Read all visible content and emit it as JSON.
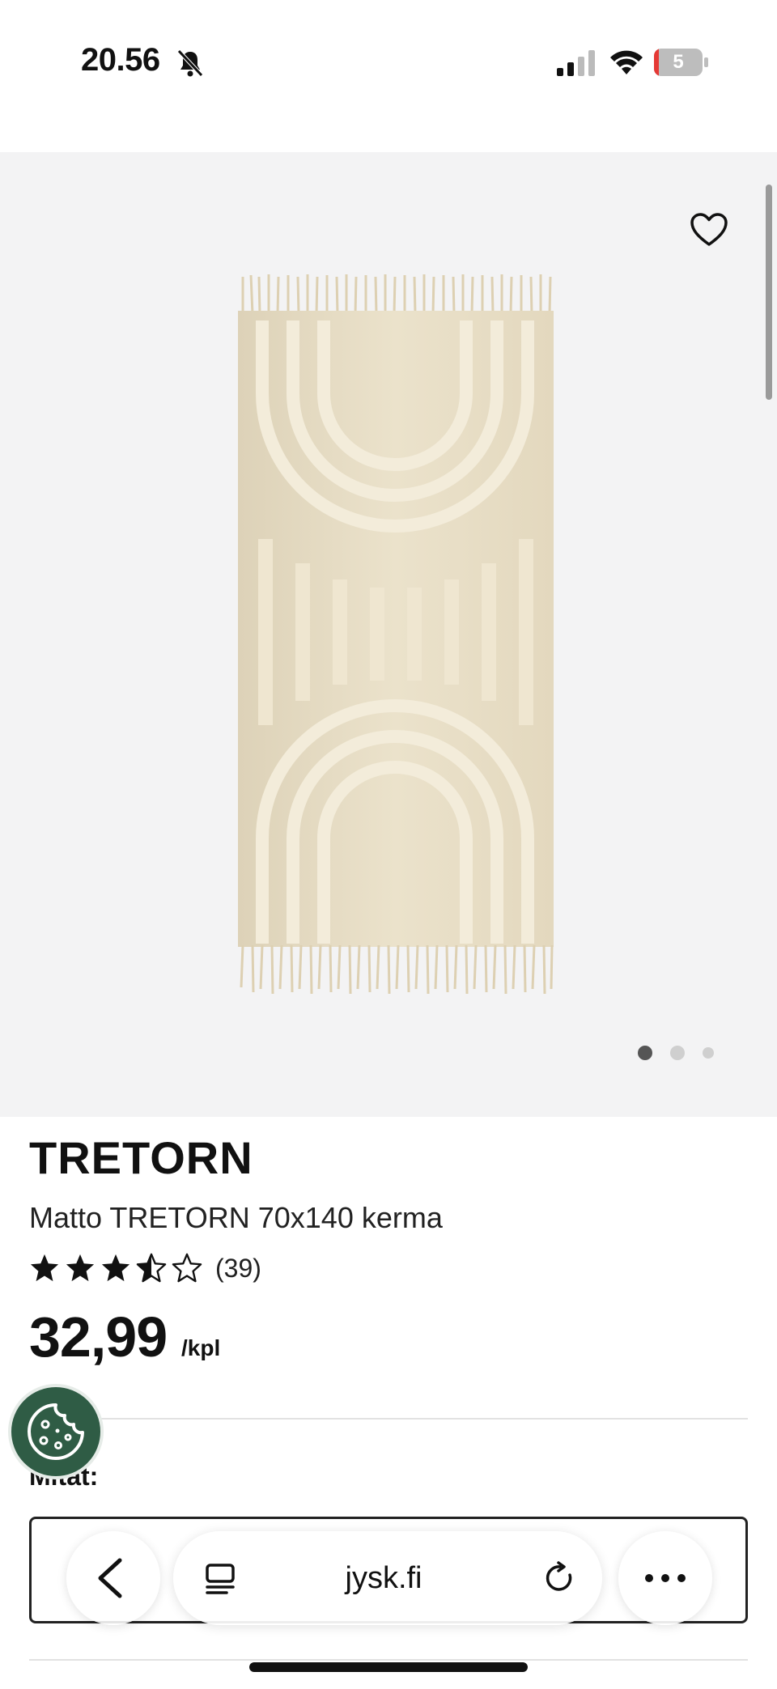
{
  "status_bar": {
    "time": "20.56",
    "battery_level": "5",
    "icons": [
      "bell-slash-icon",
      "cellular-signal-icon",
      "wifi-icon",
      "battery-icon"
    ]
  },
  "gallery": {
    "image_alt": "rug-image",
    "favorite_icon": "heart-icon",
    "pagination": {
      "total": 3,
      "active_index": 0
    }
  },
  "product": {
    "brand": "TRETORN",
    "name": "Matto TRETORN 70x140 kerma",
    "rating": {
      "value": 3.5,
      "max": 5,
      "count_text": "(39)"
    },
    "price": "32,99",
    "unit": "/kpl"
  },
  "options": {
    "dimensions_label": "Mitat:"
  },
  "cookie_button": {
    "icon": "cookie-icon"
  },
  "browser": {
    "url": "jysk.fi",
    "icons": [
      "back-chevron-icon",
      "reader-icon",
      "reload-icon",
      "more-icon"
    ]
  },
  "colors": {
    "gallery_bg": "#f3f3f4",
    "cookie_bg": "#2f5c45",
    "rug": "#e6dcc3"
  }
}
